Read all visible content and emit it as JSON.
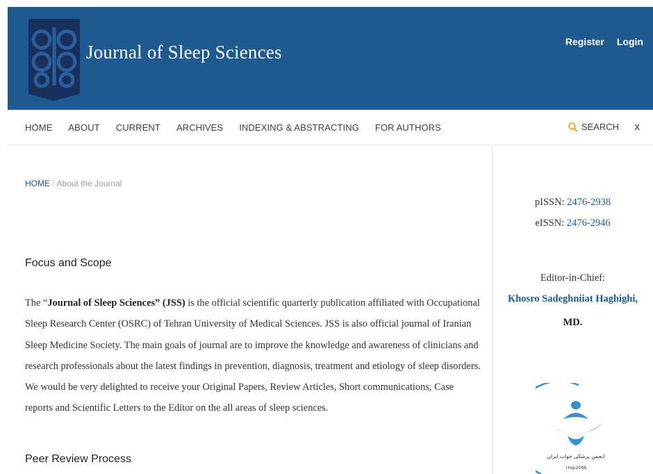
{
  "header": {
    "title": "Journal of Sleep Sciences",
    "register": "Register",
    "login": "Login",
    "brand_color": "#1e5a8f"
  },
  "nav": {
    "items": [
      "HOME",
      "ABOUT",
      "CURRENT",
      "ARCHIVES",
      "INDEXING & ABSTRACTING",
      "FOR AUTHORS"
    ],
    "search": "SEARCH",
    "close": "x"
  },
  "breadcrumb": {
    "home": "HOME",
    "sep": "/",
    "current": "About the Journal"
  },
  "focus": {
    "title": "Focus and Scope",
    "intro": "The “",
    "bold": "Journal of Sleep Sciences” (JSS)",
    "body": " is the official scientific quarterly publication affiliated with Occupational Sleep Research Center (OSRC) of Tehran University of Medical Sciences. JSS is also official journal of Iranian Sleep Medicine Society. The main goals of journal are to improve the knowledge and awareness of clinicians and research professionals about the latest findings in prevention, diagnosis, treatment and etiology of sleep disorders. We would be very delighted to receive your Original Papers, Review Articles, Short communications, Case reports and Scientific Letters to the Editor on the all areas of sleep sciences."
  },
  "peer": {
    "title": "Peer Review Process"
  },
  "sidebar": {
    "pissn_label": "pISSN:",
    "pissn": "2476-2938",
    "eissn_label": "eISSN:",
    "eissn": "2476-2946",
    "editor_label": "Editor-in-Chief:",
    "editor_name": "Khosro Sadeghniiat Haghighi,",
    "editor_degree": "MD.",
    "society_text": "انجمن پزشکی خواب ایران",
    "society_year": "۱۳۸۵-2006"
  }
}
